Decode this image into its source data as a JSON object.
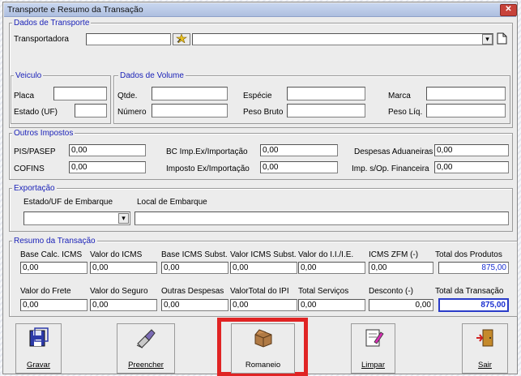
{
  "window": {
    "title": "Transporte e Resumo da Transação",
    "close_label": "✕"
  },
  "transporte": {
    "legend": "Dados de Transporte",
    "transportadora_label": "Transportadora",
    "transportadora_code": "",
    "transportadora_name": "",
    "dropdown_glyph": "▾",
    "doc_glyph": "🗋"
  },
  "veiculo": {
    "legend": "Veiculo",
    "placa_label": "Placa",
    "placa_value": "",
    "estado_label": "Estado (UF)",
    "estado_value": ""
  },
  "volume": {
    "legend": "Dados de Volume",
    "qtde_label": "Qtde.",
    "qtde_value": "",
    "numero_label": "Número",
    "numero_value": "",
    "especie_label": "Espécie",
    "especie_value": "",
    "peso_bruto_label": "Peso Bruto",
    "peso_bruto_value": "",
    "marca_label": "Marca",
    "marca_value": "",
    "peso_liq_label": "Peso Líq.",
    "peso_liq_value": ""
  },
  "impostos": {
    "legend": "Outros Impostos",
    "pis_label": "PIS/PASEP",
    "pis_value": "0,00",
    "cofins_label": "COFINS",
    "cofins_value": "0,00",
    "bc_label": "BC Imp.Ex/Importação",
    "bc_value": "0,00",
    "imposto_label": "Imposto Ex/Importação",
    "imposto_value": "0,00",
    "despesas_label": "Despesas Aduaneiras",
    "despesas_value": "0,00",
    "iof_label": "Imp. s/Op. Financeira",
    "iof_value": "0,00"
  },
  "exportacao": {
    "legend": "Exportação",
    "estado_label": "Estado/UF de Embarque",
    "estado_value": "",
    "local_label": "Local de Embarque",
    "local_value": ""
  },
  "resumo": {
    "legend": "Resumo da Transação",
    "row1_labels": [
      "Base Calc. ICMS",
      "Valor do ICMS",
      "Base ICMS Subst.",
      "Valor ICMS Subst.",
      "Valor do I.I./I.E.",
      "ICMS ZFM (-)",
      "Total dos Produtos"
    ],
    "row1_values": [
      "0,00",
      "0,00",
      "0,00",
      "0,00",
      "0,00",
      "0,00",
      "875,00"
    ],
    "row2_labels": [
      "Valor do Frete",
      "Valor do Seguro",
      "Outras Despesas",
      "ValorTotal do IPI",
      "Total Serviços",
      "Desconto (-)",
      "Total da Transação"
    ],
    "row2_values": [
      "0,00",
      "0,00",
      "0,00",
      "0,00",
      "0,00",
      "0,00",
      "875,00"
    ]
  },
  "buttons": {
    "gravar": "Gravar",
    "preencher": "Preencher",
    "romaneio": "Romaneio",
    "limpar": "Limpar",
    "sair": "Sair"
  },
  "colors": {
    "legend": "#1b22b8",
    "highlight": "#e02424",
    "total_value": "#1a2ed0"
  }
}
